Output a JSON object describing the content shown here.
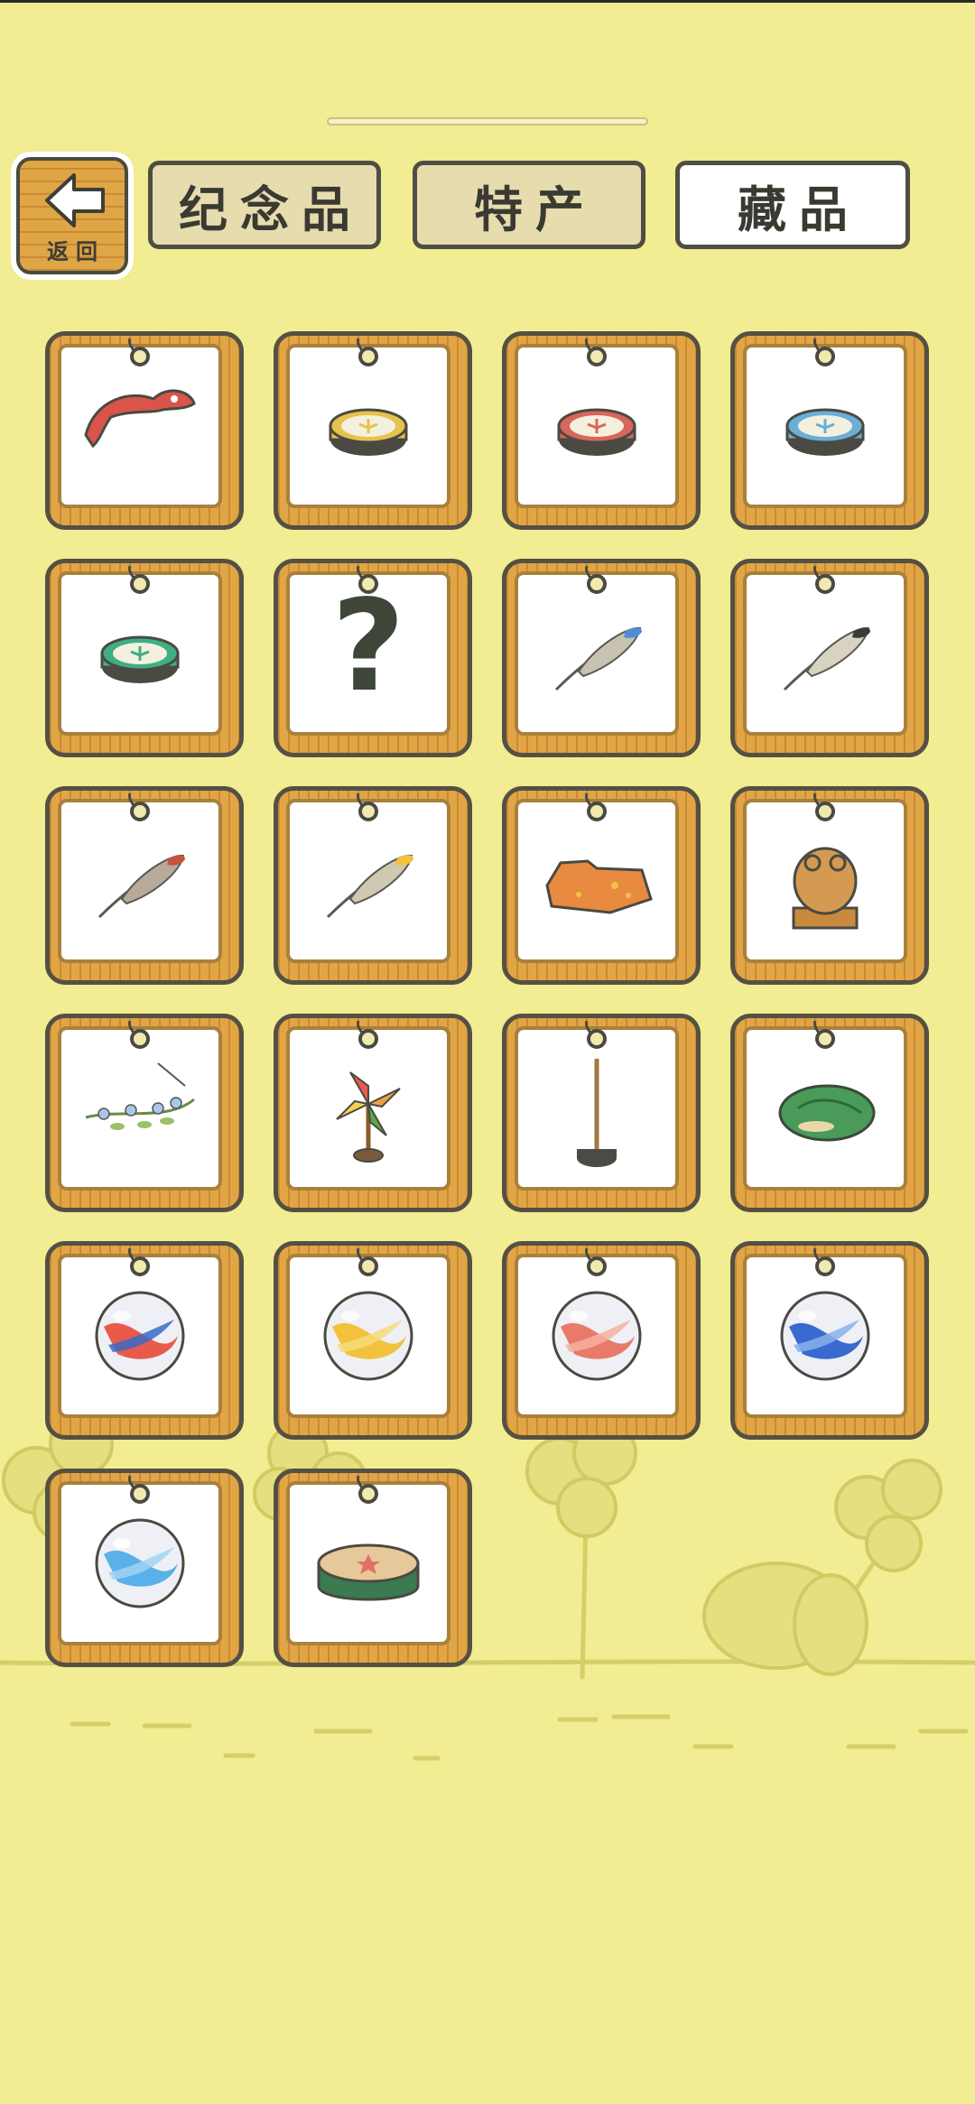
{
  "nav": {
    "back_label": "返回",
    "tabs": [
      {
        "label": "纪念品",
        "active": false
      },
      {
        "label": "特产",
        "active": false
      },
      {
        "label": "藏品",
        "active": true
      }
    ]
  },
  "colors": {
    "background": "#f2ec92",
    "frame_wood": "#e2a545",
    "frame_border": "#545043",
    "tab_inactive": "#e6dcae",
    "tab_active": "#ffffff"
  },
  "collection": {
    "items": [
      {
        "icon": "red-fish-charm-icon"
      },
      {
        "icon": "yellow-frog-token-icon"
      },
      {
        "icon": "red-frog-token-icon"
      },
      {
        "icon": "blue-frog-token-icon"
      },
      {
        "icon": "green-frog-token-icon"
      },
      {
        "icon": "question-mark-icon"
      },
      {
        "icon": "blue-tip-feather-icon"
      },
      {
        "icon": "speckled-feather-icon"
      },
      {
        "icon": "red-feather-icon"
      },
      {
        "icon": "yellow-tip-feather-icon"
      },
      {
        "icon": "orange-cloth-icon"
      },
      {
        "icon": "frog-statue-icon"
      },
      {
        "icon": "flower-sprig-icon"
      },
      {
        "icon": "pinwheel-icon"
      },
      {
        "icon": "wooden-stand-icon"
      },
      {
        "icon": "green-turtle-stone-icon"
      },
      {
        "icon": "rainbow-marble-icon"
      },
      {
        "icon": "yellow-marble-icon"
      },
      {
        "icon": "pink-marble-icon"
      },
      {
        "icon": "blue-marble-icon"
      },
      {
        "icon": "light-blue-marble-icon"
      },
      {
        "icon": "green-drum-icon"
      }
    ]
  }
}
